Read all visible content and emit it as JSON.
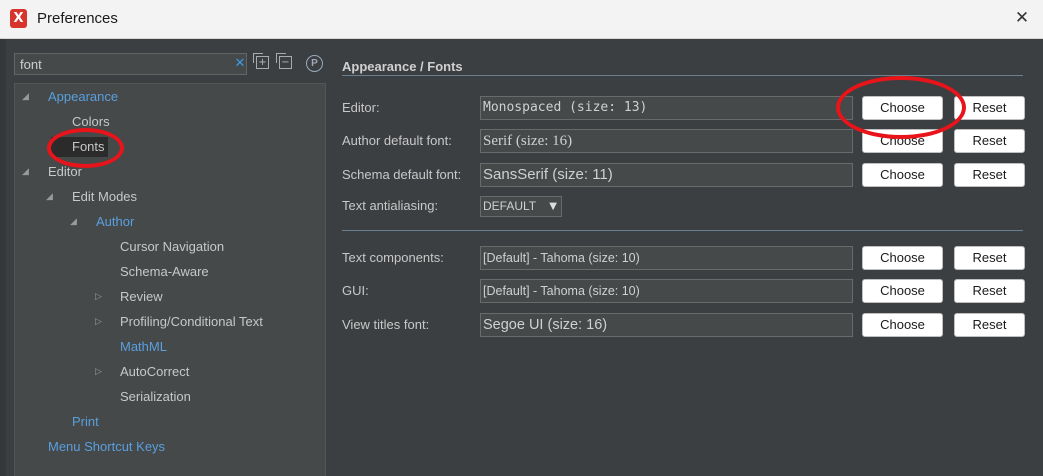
{
  "window": {
    "title": "Preferences",
    "app_icon_glyph": "X",
    "close_icon": "close-icon"
  },
  "sidebar": {
    "search": {
      "value": "font",
      "placeholder": ""
    },
    "clear_glyph": "✕",
    "profile_glyph": "P",
    "expand_glyph": "+",
    "collapse_glyph": "−",
    "tree": [
      {
        "label": "Appearance",
        "expanded": true,
        "color": "#5a9fde"
      },
      {
        "label": "Colors"
      },
      {
        "label": "Fonts",
        "selected": true
      },
      {
        "label": "Editor",
        "expanded": true
      },
      {
        "label": "Edit Modes",
        "expanded": true
      },
      {
        "label": "Author",
        "expanded": true,
        "color": "#5a9fde"
      },
      {
        "label": "Cursor Navigation"
      },
      {
        "label": "Schema-Aware"
      },
      {
        "label": "Review",
        "collapsed": true
      },
      {
        "label": "Profiling/Conditional Text",
        "collapsed": true
      },
      {
        "label": "MathML",
        "color": "#5a9fde"
      },
      {
        "label": "AutoCorrect",
        "collapsed": true
      },
      {
        "label": "Serialization"
      },
      {
        "label": "Print",
        "color": "#5a9fde"
      },
      {
        "label": "Menu Shortcut Keys",
        "color": "#5a9fde"
      }
    ]
  },
  "glyphs": {
    "expanded": "◢",
    "collapsed": "▷",
    "dropdown": "▼"
  },
  "main": {
    "section_title": "Appearance / Fonts",
    "choose_label": "Choose",
    "reset_label": "Reset",
    "rows": [
      {
        "label": "Editor:",
        "value": "Monospaced (size: 13)"
      },
      {
        "label": "Author default font:",
        "value": "Serif (size: 16)"
      },
      {
        "label": "Schema default font:",
        "value": "SansSerif (size: 11)"
      },
      {
        "label": "Text components:",
        "value": "[Default] - Tahoma (size: 10)"
      },
      {
        "label": "GUI:",
        "value": "[Default] - Tahoma (size: 10)"
      },
      {
        "label": "View titles font:",
        "value": "Segoe UI (size: 16)"
      }
    ],
    "antialiasing": {
      "label": "Text antialiasing:",
      "value": "DEFAULT"
    }
  },
  "colors": {
    "annotation": "#e8141a",
    "link_blue": "#5a9fde",
    "panel_bg": "#3c3f41"
  }
}
